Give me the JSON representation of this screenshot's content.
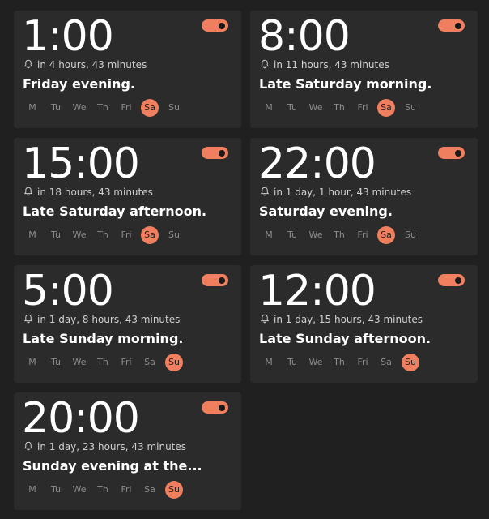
{
  "accent_color": "#f07f5f",
  "alarms": [
    {
      "time": "1:00",
      "remaining": "in 4 hours, 43 minutes",
      "label": "Friday evening.",
      "enabled": true,
      "days": [
        "M",
        "Tu",
        "We",
        "Th",
        "Fri",
        "Sa",
        "Su"
      ],
      "active_days": [
        "Sa"
      ]
    },
    {
      "time": "8:00",
      "remaining": "in 11 hours, 43 minutes",
      "label": "Late Saturday morning.",
      "enabled": true,
      "days": [
        "M",
        "Tu",
        "We",
        "Th",
        "Fri",
        "Sa",
        "Su"
      ],
      "active_days": [
        "Sa"
      ]
    },
    {
      "time": "15:00",
      "remaining": "in 18 hours, 43 minutes",
      "label": "Late Saturday afternoon.",
      "enabled": true,
      "days": [
        "M",
        "Tu",
        "We",
        "Th",
        "Fri",
        "Sa",
        "Su"
      ],
      "active_days": [
        "Sa"
      ]
    },
    {
      "time": "22:00",
      "remaining": "in 1 day, 1 hour, 43 minutes",
      "label": "Saturday evening.",
      "enabled": true,
      "days": [
        "M",
        "Tu",
        "We",
        "Th",
        "Fri",
        "Sa",
        "Su"
      ],
      "active_days": [
        "Sa"
      ]
    },
    {
      "time": "5:00",
      "remaining": "in 1 day, 8 hours, 43 minutes",
      "label": "Late Sunday morning.",
      "enabled": true,
      "days": [
        "M",
        "Tu",
        "We",
        "Th",
        "Fri",
        "Sa",
        "Su"
      ],
      "active_days": [
        "Su"
      ]
    },
    {
      "time": "12:00",
      "remaining": "in 1 day, 15 hours, 43 minutes",
      "label": "Late Sunday afternoon.",
      "enabled": true,
      "days": [
        "M",
        "Tu",
        "We",
        "Th",
        "Fri",
        "Sa",
        "Su"
      ],
      "active_days": [
        "Su"
      ]
    },
    {
      "time": "20:00",
      "remaining": "in 1 day, 23 hours, 43 minutes",
      "label": "Sunday evening at the...",
      "enabled": true,
      "days": [
        "M",
        "Tu",
        "We",
        "Th",
        "Fri",
        "Sa",
        "Su"
      ],
      "active_days": [
        "Su"
      ]
    }
  ]
}
